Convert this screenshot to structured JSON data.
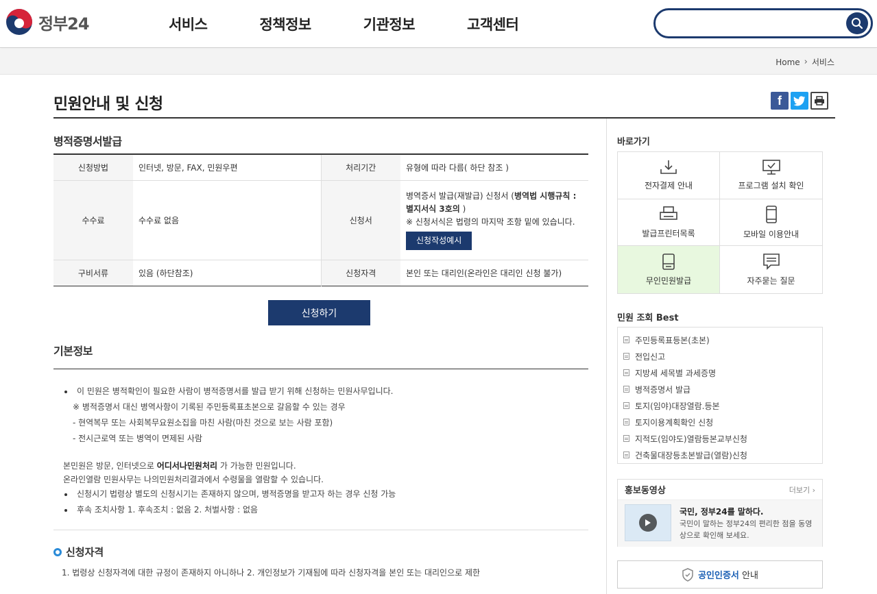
{
  "header": {
    "logo_text": "정부24",
    "nav": [
      "서비스",
      "정책정보",
      "기관정보",
      "고객센터"
    ],
    "search_placeholder": ""
  },
  "breadcrumb": {
    "home": "Home",
    "current": "서비스"
  },
  "page": {
    "title": "민원안내 및 신청"
  },
  "main": {
    "section_title": "병적증명서발급",
    "table": {
      "method_label": "신청방법",
      "method_value": "인터넷, 방문, FAX, 민원우편",
      "period_label": "처리기간",
      "period_value": "유형에 따라 다름( 하단 참조 )",
      "fee_label": "수수료",
      "fee_value": "수수료 없음",
      "form_label": "신청서",
      "form_text_1": "병역증서 발급(재발급) 신청서 (",
      "form_text_bold": "병역법 시행규칙 : 별지서식 3호의",
      "form_text_2": ")",
      "form_note": "※ 신청서식은 법령의 마지막 조항 밑에 있습니다.",
      "form_sample_button": "신청작성예시",
      "docs_label": "구비서류",
      "docs_value": "있음 (하단참조)",
      "qual_label": "신청자격",
      "qual_value": "본인 또는 대리인(온라인은 대리인 신청 불가)"
    },
    "apply_button": "신청하기",
    "basic_title": "기본정보",
    "basic": {
      "b1": "이 민원은 병적확인이 필요한 사람이 병적증명서를 발급 받기 위해 신청하는 민원사무입니다.",
      "n1": "※ 병적증명서 대신 병역사항이 기록된 주민등록표초본으로 갈음할 수 있는 경우",
      "n2": "- 현역복무 또는 사회복무요원소집을 마친 사람(마친 것으로 보는 사람 포함)",
      "n3": "- 전시근로역 또는 병역이 면제된 사람",
      "p1_pre": "본민원은 방문, 인터넷으로 ",
      "p1_bold": "어디서나민원처리",
      "p1_post": " 가 가능한 민원입니다.",
      "p2": "온라인열람 민원사무는 나의민원처리결과에서 수령물을 열람할 수 있습니다.",
      "b2": "신청시기 법령상 별도의 신청시기는 존재하지 않으며, 병적증명을 받고자 하는 경우 신청 가능",
      "b3": "후속 조치사항 1. 후속조치 : 없음 2. 처벌사항 : 없음"
    },
    "qual_title": "신청자격",
    "qual_text": "1. 법령상 신청자격에 대한 규정이 존재하지 아니하나 2. 개인정보가 기재됨에 따라 신청자격을 본인 또는 대리인으로 제한"
  },
  "side": {
    "quick_title": "바로가기",
    "quick": [
      "전자결제 안내",
      "프로그램 설치 확인",
      "발급프린터목록",
      "모바일 이용안내",
      "무인민원발급",
      "자주묻는 질문"
    ],
    "best_title": "민원 조회 Best",
    "best": [
      "주민등록표등본(초본)",
      "전입신고",
      "지방세 세목별 과세증명",
      "병적증명서 발급",
      "토지(임야)대장열람.등본",
      "토지이용계획확인 신청",
      "지적도(임야도)열람등본교부신청",
      "건축물대장등초본발급(열람)신청"
    ],
    "promo_title": "홍보동영상",
    "promo_more": "더보기 ›",
    "promo_video_title": "국민, 정부24를 말하다.",
    "promo_video_desc": "국민이 말하는 정부24의 편리한 점을 동영상으로 확인해 보세요.",
    "cert_blue": "공인인증서",
    "cert_rest": " 안내"
  },
  "colors": {
    "brand_navy": "#1c3a6e",
    "accent_blue": "#2a8bd8",
    "highlight_green": "#e8f8df"
  }
}
